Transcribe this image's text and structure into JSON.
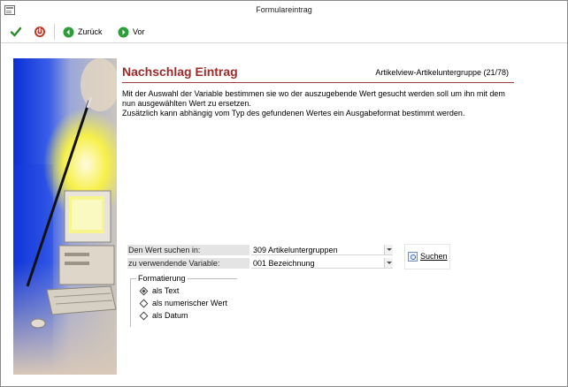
{
  "window": {
    "title": "Formulareintrag"
  },
  "toolbar": {
    "ok_icon": "check-icon",
    "cancel_icon": "power-icon",
    "back_label": "Zurück",
    "forward_label": "Vor",
    "colors": {
      "ok": "#2e8b2e",
      "cancel": "#c0392b",
      "nav": "#2f9e3a"
    }
  },
  "header": {
    "title": "Nachschlag Eintrag",
    "context": "Artikelview-Artikeluntergruppe (21/78)",
    "accent": "#9e2a2a"
  },
  "description": {
    "line1": "Mit der Auswahl der Variable bestimmen sie wo der auszugebende Wert gesucht werden soll um ihn mit dem",
    "line2": "nun ausgewählten Wert zu ersetzen.",
    "line3": "Zusätzlich kann abhängig vom Typ des gefundenen Wertes ein Ausgabeformat bestimmt werden."
  },
  "form": {
    "search_in_label": "Den Wert suchen in:",
    "search_in_value": "309 Artikeluntergruppen",
    "variable_label": "zu verwendende Variable:",
    "variable_value": "001 Bezeichnung",
    "search_button": "Suchen"
  },
  "formatting": {
    "title": "Formatierung",
    "options": [
      {
        "label": "als Text",
        "selected": true
      },
      {
        "label": "als numerischer Wert",
        "selected": false
      },
      {
        "label": "als Datum",
        "selected": false
      }
    ]
  }
}
